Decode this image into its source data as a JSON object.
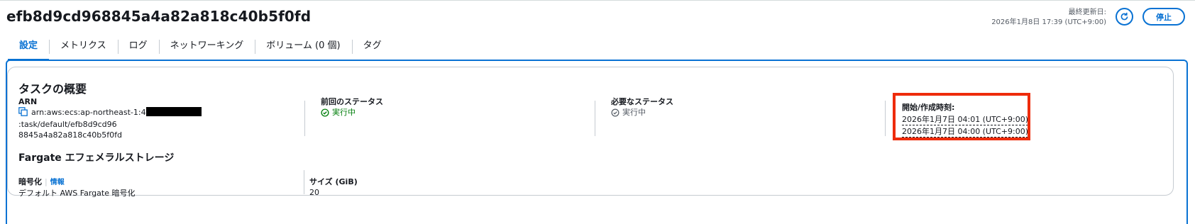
{
  "header": {
    "task_id": "efb8d9cd968845a4a82a818c40b5f0fd",
    "last_updated_label": "最終更新日:",
    "last_updated_value": "2026年1月8日 17:39 (UTC+9:00)",
    "stop_label": "停止"
  },
  "tabs": [
    {
      "label": "設定",
      "active": true
    },
    {
      "label": "メトリクス"
    },
    {
      "label": "ログ"
    },
    {
      "label": "ネットワーキング"
    },
    {
      "label": "ボリューム (0 個)"
    },
    {
      "label": "タグ"
    }
  ],
  "overview": {
    "title": "タスクの概要",
    "arn": {
      "label": "ARN",
      "prefix": "arn:aws:ecs:ap-northeast-1:4",
      "suffix": ":task/default/efb8d9cd96",
      "line2": "8845a4a82a818c40b5f0fd"
    },
    "last_status": {
      "label": "前回のステータス",
      "value": "実行中"
    },
    "desired_status": {
      "label": "必要なステータス",
      "value": "実行中"
    },
    "started": {
      "label": "開始/作成時刻:",
      "line1": "2026年1月7日 04:01 (UTC+9:00)",
      "line2": "2026年1月7日 04:00 (UTC+9:00)"
    }
  },
  "storage": {
    "title": "Fargate エフェメラルストレージ",
    "encryption": {
      "label": "暗号化",
      "info": "情報",
      "value": "デフォルト AWS Fargate 暗号化"
    },
    "size": {
      "label": "サイズ (GiB)",
      "value": "20"
    }
  },
  "colors": {
    "accent": "#0972d3",
    "success": "#037f0c",
    "highlight": "#ee2b0b"
  },
  "icons": [
    "refresh-icon",
    "copy-icon",
    "check-circle-icon",
    "check-circle-outline-icon"
  ]
}
